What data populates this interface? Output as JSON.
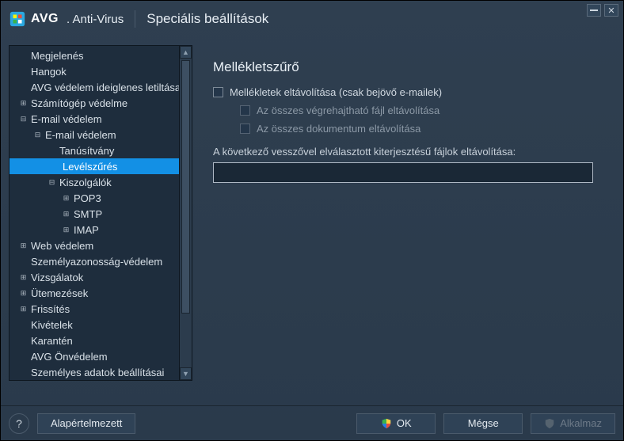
{
  "titlebar": {
    "brand": "AVG",
    "brand_sub": ". Anti-Virus",
    "title": "Speciális beállítások"
  },
  "tree": [
    {
      "label": "Megjelenés",
      "depth": 0,
      "exp": ""
    },
    {
      "label": "Hangok",
      "depth": 0,
      "exp": ""
    },
    {
      "label": "AVG védelem ideiglenes letiltása",
      "depth": 0,
      "exp": ""
    },
    {
      "label": "Számítógép védelme",
      "depth": 0,
      "exp": "+"
    },
    {
      "label": "E-mail védelem",
      "depth": 0,
      "exp": "-"
    },
    {
      "label": "E-mail védelem",
      "depth": 1,
      "exp": "-"
    },
    {
      "label": "Tanúsítvány",
      "depth": 2,
      "exp": ""
    },
    {
      "label": "Levélszűrés",
      "depth": 2,
      "exp": "",
      "sel": true
    },
    {
      "label": "Kiszolgálók",
      "depth": 2,
      "exp": "-"
    },
    {
      "label": "POP3",
      "depth": 3,
      "exp": "+"
    },
    {
      "label": "SMTP",
      "depth": 3,
      "exp": "+"
    },
    {
      "label": "IMAP",
      "depth": 3,
      "exp": "+"
    },
    {
      "label": "Web védelem",
      "depth": 0,
      "exp": "+"
    },
    {
      "label": "Személyazonosság-védelem",
      "depth": 0,
      "exp": ""
    },
    {
      "label": "Vizsgálatok",
      "depth": 0,
      "exp": "+"
    },
    {
      "label": "Ütemezések",
      "depth": 0,
      "exp": "+"
    },
    {
      "label": "Frissítés",
      "depth": 0,
      "exp": "+"
    },
    {
      "label": "Kivételek",
      "depth": 0,
      "exp": ""
    },
    {
      "label": "Karantén",
      "depth": 0,
      "exp": ""
    },
    {
      "label": "AVG Önvédelem",
      "depth": 0,
      "exp": ""
    },
    {
      "label": "Személyes adatok beállításai",
      "depth": 0,
      "exp": ""
    }
  ],
  "panel": {
    "title": "Mellékletszűrő",
    "chk1": "Mellékletek eltávolítása (csak bejövő e-mailek)",
    "chk2": "Az összes végrehajtható fájl eltávolítása",
    "chk3": "Az összes dokumentum eltávolítása",
    "field_label": "A következő vesszővel elválasztott kiterjesztésű fájlok eltávolítása:",
    "field_value": ""
  },
  "footer": {
    "default": "Alapértelmezett",
    "ok": "OK",
    "cancel": "Mégse",
    "apply": "Alkalmaz"
  }
}
